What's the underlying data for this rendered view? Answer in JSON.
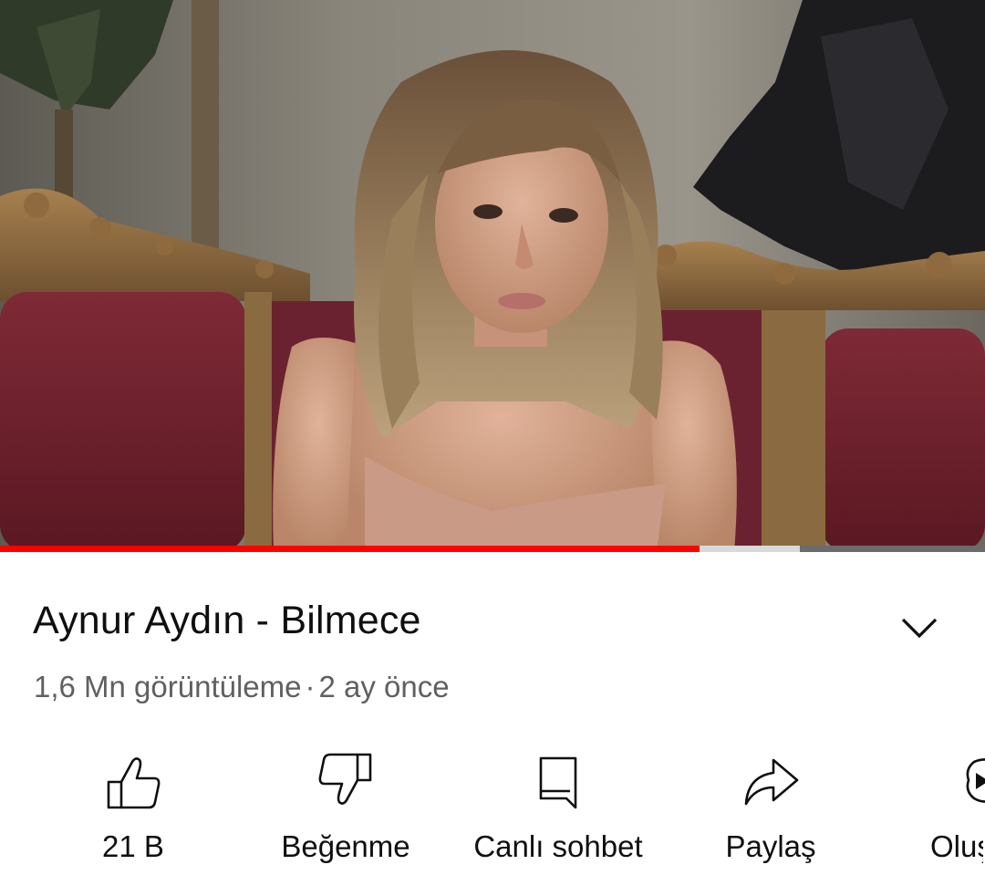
{
  "video": {
    "title": "Aynur Aydın - Bilmece",
    "views": "1,6 Mn görüntüleme",
    "separator": "·",
    "age": "2 ay önce",
    "progress": 0.71,
    "buffered": 0.812
  },
  "actions": {
    "like": {
      "label": "21 B",
      "icon": "thumbs-up-icon"
    },
    "dislike": {
      "label": "Beğenme",
      "icon": "thumbs-down-icon"
    },
    "live_chat": {
      "label": "Canlı sohbet",
      "icon": "chat-icon"
    },
    "share": {
      "label": "Paylaş",
      "icon": "share-icon"
    },
    "create": {
      "label": "Oluş",
      "icon": "create-icon"
    }
  },
  "colors": {
    "progress": "#ff0000",
    "text_primary": "#0f0f0f",
    "text_secondary": "#606060"
  }
}
